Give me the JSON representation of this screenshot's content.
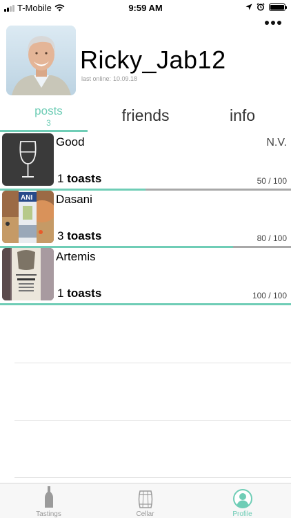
{
  "status_bar": {
    "carrier": "T-Mobile",
    "time": "9:59 AM",
    "battery_level": 1.0
  },
  "profile": {
    "username": "Ricky_Jab12",
    "last_online_label": "last online:",
    "last_online_date": "10.09.18"
  },
  "tabs": {
    "posts_label": "posts",
    "posts_count": "3",
    "friends_label": "friends",
    "info_label": "info",
    "active": "posts"
  },
  "posts": [
    {
      "title": "Good",
      "vintage": "N.V.",
      "toasts_count": "1",
      "toasts_word": "toasts",
      "score": "50 / 100",
      "score_value": 50,
      "thumb_icon": "wine-glass-icon"
    },
    {
      "title": "Dasani",
      "vintage": "",
      "toasts_count": "3",
      "toasts_word": "toasts",
      "score": "80 / 100",
      "score_value": 80,
      "thumb_icon": "photo-bottle"
    },
    {
      "title": "Artemis",
      "vintage": "",
      "toasts_count": "1",
      "toasts_word": "toasts",
      "score": "100 / 100",
      "score_value": 100,
      "thumb_icon": "photo-wine-label"
    }
  ],
  "tabbar": {
    "items": [
      {
        "label": "Tastings",
        "icon": "bottle-icon"
      },
      {
        "label": "Cellar",
        "icon": "barrel-icon"
      },
      {
        "label": "Profile",
        "icon": "profile-icon"
      }
    ],
    "active_index": 2
  },
  "colors": {
    "accent": "#6fcdb6",
    "track": "#a8a8a8"
  }
}
